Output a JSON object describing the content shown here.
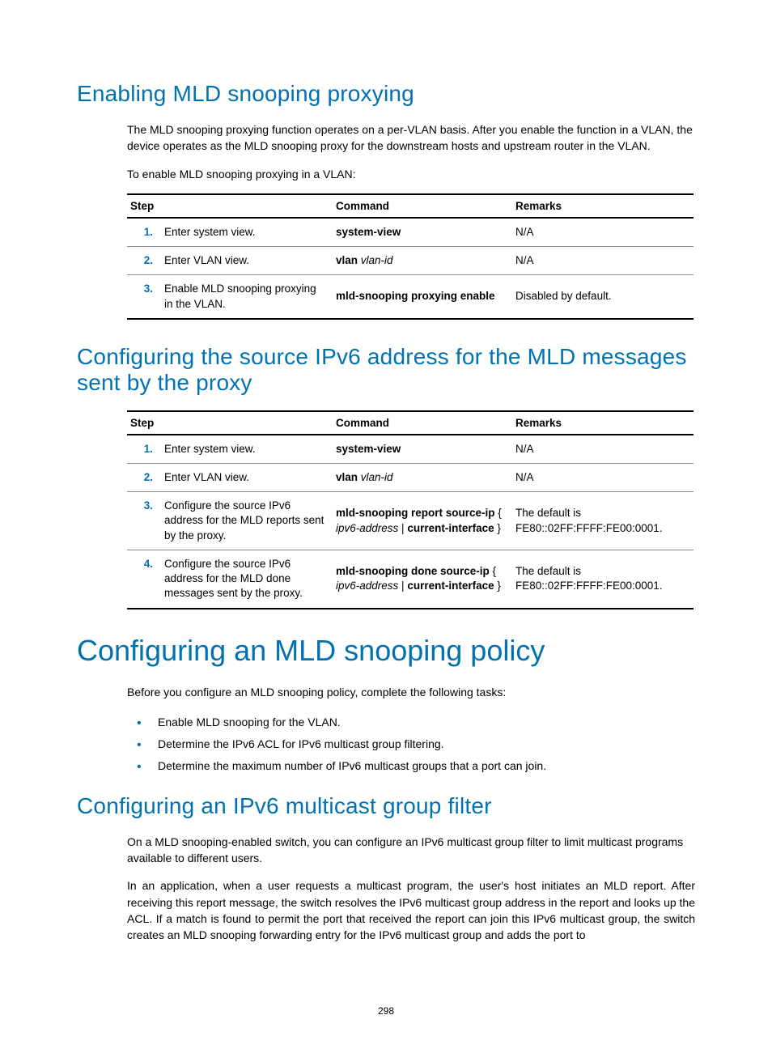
{
  "section1": {
    "heading": "Enabling MLD snooping proxying",
    "para1": "The MLD snooping proxying function operates on a per-VLAN basis. After you enable the function in a VLAN, the device operates as the MLD snooping proxy for the downstream hosts and upstream router in the VLAN.",
    "para2": "To enable MLD snooping proxying in a VLAN:",
    "table": {
      "headers": {
        "step": "Step",
        "command": "Command",
        "remarks": "Remarks"
      },
      "rows": [
        {
          "num": "1.",
          "step": "Enter system view.",
          "command_bold": "system-view",
          "command_ital": "",
          "remarks": "N/A"
        },
        {
          "num": "2.",
          "step": "Enter VLAN view.",
          "command_bold": "vlan",
          "command_ital": " vlan-id",
          "remarks": "N/A"
        },
        {
          "num": "3.",
          "step": "Enable MLD snooping proxying in the VLAN.",
          "command_bold": "mld-snooping proxying enable",
          "command_ital": "",
          "remarks": "Disabled by default."
        }
      ]
    }
  },
  "section2": {
    "heading": "Configuring the source IPv6 address for the MLD messages sent by the proxy",
    "table": {
      "headers": {
        "step": "Step",
        "command": "Command",
        "remarks": "Remarks"
      },
      "rows": [
        {
          "num": "1.",
          "step": "Enter system view.",
          "command_html": "<span class=\"bold\">system-view</span>",
          "remarks": "N/A"
        },
        {
          "num": "2.",
          "step": "Enter VLAN view.",
          "command_html": "<span class=\"bold\">vlan</span> <span class=\"ital\">vlan-id</span>",
          "remarks": "N/A"
        },
        {
          "num": "3.",
          "step": "Configure the source IPv6 address for the MLD reports sent by the proxy.",
          "command_html": "<span class=\"bold\">mld-snooping report source-ip</span> { <span class=\"ital\">ipv6-address</span> | <span class=\"bold\">current-interface</span> }",
          "remarks": "The default is FE80::02FF:FFFF:FE00:0001."
        },
        {
          "num": "4.",
          "step": "Configure the source IPv6 address for the MLD done messages sent by the proxy.",
          "command_html": "<span class=\"bold\">mld-snooping done source-ip</span> { <span class=\"ital\">ipv6-address</span> | <span class=\"bold\">current-interface</span> }",
          "remarks": "The default is FE80::02FF:FFFF:FE00:0001."
        }
      ]
    }
  },
  "section3": {
    "heading": "Configuring an MLD snooping policy",
    "para": "Before you configure an MLD snooping policy, complete the following tasks:",
    "bullets": [
      "Enable MLD snooping for the VLAN.",
      "Determine the IPv6 ACL for IPv6 multicast group filtering.",
      "Determine the maximum number of IPv6 multicast groups that a port can join."
    ]
  },
  "section4": {
    "heading": "Configuring an IPv6 multicast group filter",
    "para1": "On a MLD snooping-enabled switch, you can configure an IPv6 multicast group filter to limit multicast programs available to different users.",
    "para2": "In an application, when a user requests a multicast program, the user's host initiates an MLD report. After receiving this report message, the switch resolves the IPv6 multicast group address in the report and looks up the ACL. If a match is found to permit the port that received the report can join this IPv6 multicast group, the switch creates an MLD snooping forwarding entry for the IPv6 multicast group and adds the port to"
  },
  "pageNumber": "298"
}
